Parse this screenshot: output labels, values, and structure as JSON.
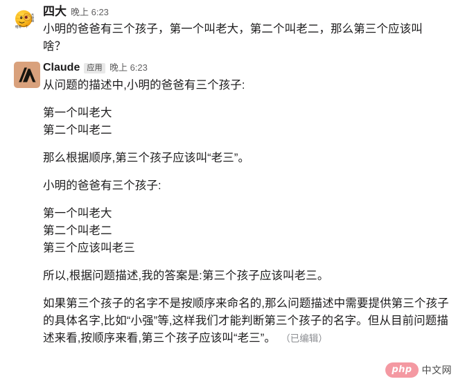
{
  "colors": {
    "background": "#ffffff",
    "text": "#1d1c1d",
    "muted": "#616061",
    "claude_avatar": "#d9a17c",
    "badge_bg": "#e8e8e8",
    "watermark_pill": "#f4949e"
  },
  "messages": [
    {
      "sender": "四大",
      "timestamp": "晚上 6:23",
      "avatar_icon": "emoji-avatar-icon",
      "badge": null,
      "paragraphs": [
        "小明的爸爸有三个孩子，第一个叫老大，第二个叫老二，那么第三个应该叫啥？"
      ]
    },
    {
      "sender": "Claude",
      "badge": "应用",
      "timestamp": "晚上 6:23",
      "avatar_icon": "claude-logo-icon",
      "paragraphs": [
        "从问题的描述中,小明的爸爸有三个孩子:",
        "第一个叫老大",
        "第二个叫老二",
        "那么根据顺序,第三个孩子应该叫“老三”。",
        "小明的爸爸有三个孩子:",
        "第一个叫老大",
        "第二个叫老二",
        "第三个应该叫老三",
        "所以,根据问题描述,我的答案是:第三个孩子应该叫老三。",
        "如果第三个孩子的名字不是按顺序来命名的,那么问题描述中需要提供第三个孩子的具体名字,比如“小强”等,这样我们才能判断第三个孩子的名字。但从目前问题描述来看,按顺序来看,第三个孩子应该叫“老三”。"
      ],
      "edited_label": "（已编辑）"
    }
  ],
  "watermark": {
    "logo_text": "php",
    "site_text": "中文网"
  }
}
